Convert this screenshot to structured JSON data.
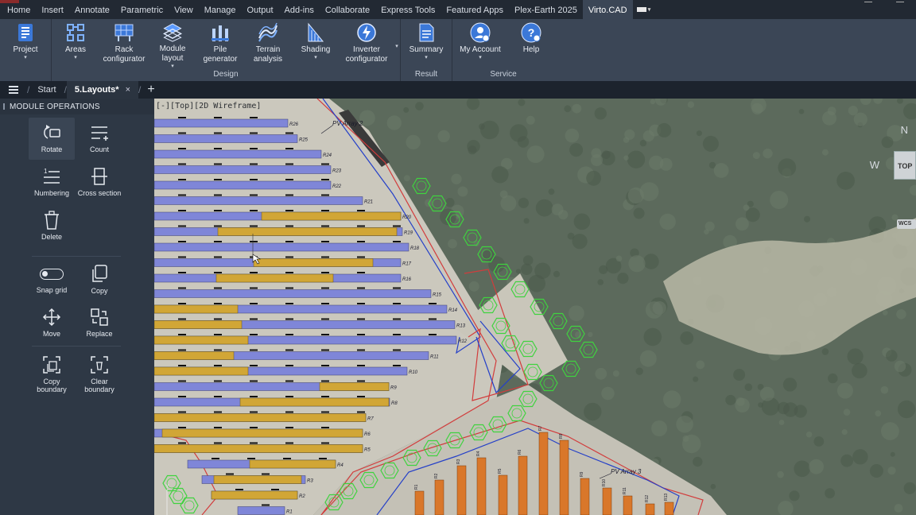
{
  "menu": {
    "items": [
      "Home",
      "Insert",
      "Annotate",
      "Parametric",
      "View",
      "Manage",
      "Output",
      "Add-ins",
      "Collaborate",
      "Express Tools",
      "Featured Apps",
      "Plex-Earth 2025",
      "Virto.CAD"
    ],
    "active": "Virto.CAD"
  },
  "ribbon": {
    "project": {
      "label": "Project"
    },
    "areas": {
      "label": "Areas"
    },
    "rack": {
      "label": "Rack\nconfigurator"
    },
    "module": {
      "label": "Module\nlayout"
    },
    "pile": {
      "label": "Pile\ngenerator"
    },
    "terrain": {
      "label": "Terrain\nanalysis"
    },
    "shading": {
      "label": "Shading"
    },
    "inverter": {
      "label": "Inverter\nconfigurator"
    },
    "summary": {
      "label": "Summary"
    },
    "account": {
      "label": "My Account"
    },
    "help": {
      "label": "Help"
    },
    "groups": {
      "design": "Design",
      "result": "Result",
      "service": "Service"
    }
  },
  "tabs": {
    "start": "Start",
    "layouts": "5.Layouts*",
    "close_glyph": "×",
    "add_glyph": "+"
  },
  "panel": {
    "title": "MODULE OPERATIONS",
    "ops": {
      "rotate": "Rotate",
      "count": "Count",
      "numbering": "Numbering",
      "cross_section": "Cross section",
      "delete": "Delete",
      "snap_grid": "Snap grid",
      "copy": "Copy",
      "move": "Move",
      "replace": "Replace",
      "copy_boundary": "Copy\nboundary",
      "clear_boundary": "Clear\nboundary"
    },
    "snap_grid_on": false
  },
  "viewport": {
    "label": "[-][Top][2D Wireframe]",
    "viewcube": {
      "north": "N",
      "west": "W",
      "top": "TOP",
      "wcs": "WCS"
    },
    "array_labels": [
      "PV Array 2",
      "PV Array 3"
    ],
    "row_labels": [
      "R26",
      "R25",
      "R24",
      "R23",
      "R22",
      "R21",
      "R20",
      "R19",
      "R18",
      "R17",
      "R16",
      "R15",
      "R14",
      "R13",
      "R12",
      "R11",
      "R10",
      "R9",
      "R8",
      "R7",
      "R6",
      "R5",
      "R4",
      "R3",
      "R2",
      "R1"
    ],
    "bottom_row_labels": [
      "R1",
      "R2",
      "R3",
      "R4",
      "R5",
      "R6",
      "R7",
      "R8",
      "R9",
      "R10",
      "R11",
      "R12",
      "R13",
      "R14",
      "R15"
    ],
    "colors": {
      "module_blue": "#7f86d8",
      "module_gold": "#d1a636",
      "module_orange": "#d9772a",
      "boundary_red": "#d23c3c",
      "boundary_blue": "#2540c8",
      "tree_green": "#3fd33f",
      "ribbon_bg": "#3b4656",
      "panel_bg": "#2e3845"
    }
  }
}
